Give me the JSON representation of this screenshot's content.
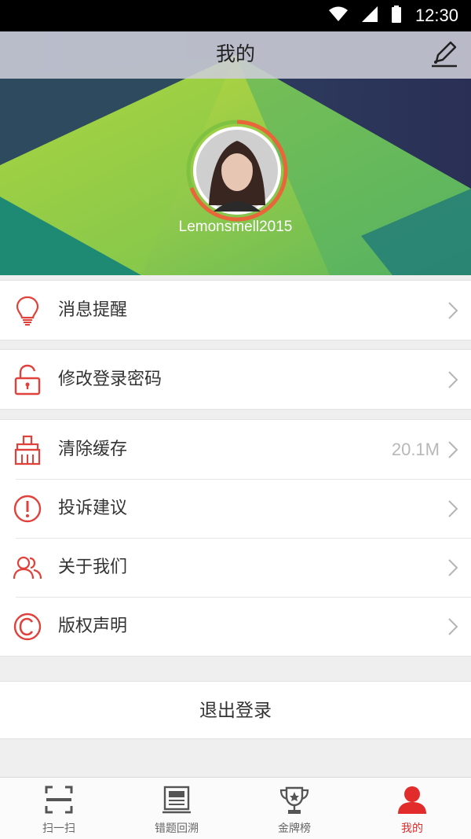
{
  "status_bar": {
    "time": "12:30"
  },
  "header": {
    "title": "我的"
  },
  "profile": {
    "username": "Lemonsmell2015"
  },
  "menu": {
    "group1": [
      {
        "label": "消息提醒",
        "icon": "lightbulb-icon"
      }
    ],
    "group2": [
      {
        "label": "修改登录密码",
        "icon": "unlock-icon"
      }
    ],
    "group3": [
      {
        "label": "清除缓存",
        "icon": "broom-icon",
        "value": "20.1M"
      },
      {
        "label": "投诉建议",
        "icon": "alert-circle-icon"
      },
      {
        "label": "关于我们",
        "icon": "users-icon"
      },
      {
        "label": "版权声明",
        "icon": "copyright-icon"
      }
    ]
  },
  "logout": {
    "label": "退出登录"
  },
  "tabs": [
    {
      "label": "扫一扫",
      "icon": "scan-icon",
      "active": false
    },
    {
      "label": "错题回溯",
      "icon": "newspaper-icon",
      "active": false
    },
    {
      "label": "金牌榜",
      "icon": "trophy-icon",
      "active": false
    },
    {
      "label": "我的",
      "icon": "person-icon",
      "active": true
    }
  ],
  "colors": {
    "accent": "#e22b2b",
    "icon_red": "#e0413a",
    "ring_orange": "#e8663a",
    "ring_green": "#7fc241"
  }
}
